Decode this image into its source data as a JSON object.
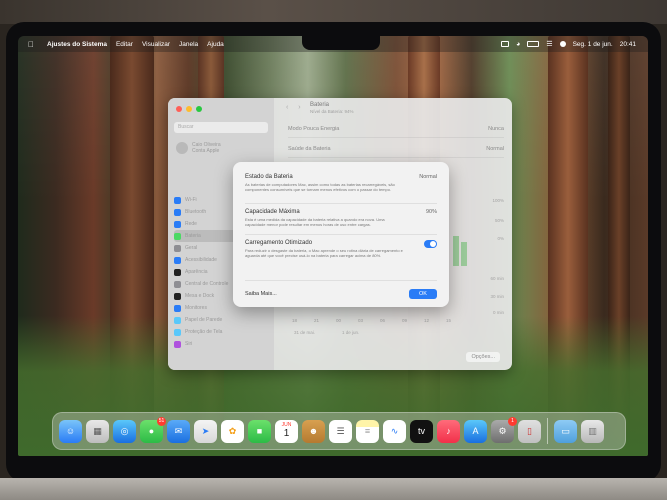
{
  "menubar": {
    "app_name": "Ajustes do Sistema",
    "menus": [
      "Editar",
      "Visualizar",
      "Janela",
      "Ajuda"
    ],
    "date": "Seg. 1 de jun.",
    "time": "20:41"
  },
  "settings_window": {
    "search_placeholder": "Buscar",
    "user_name": "Caio Oliveira",
    "user_subtitle": "Conta Apple",
    "title": "Bateria",
    "subtitle": "Nível da Bateria: 94%",
    "rows": [
      {
        "label": "Modo Pouca Energia",
        "value": "Nunca"
      },
      {
        "label": "Saúde da Bateria",
        "value": "Normal"
      }
    ],
    "sidebar_items": [
      {
        "label": "Wi-Fi",
        "color": "#2a7cf6"
      },
      {
        "label": "Bluetooth",
        "color": "#2a7cf6"
      },
      {
        "label": "Rede",
        "color": "#2a7cf6"
      },
      {
        "label": "Bateria",
        "color": "#4cd964"
      },
      {
        "label": "Geral",
        "color": "#8e8e93"
      },
      {
        "label": "Acessibilidade",
        "color": "#2a7cf6"
      },
      {
        "label": "Aparência",
        "color": "#222222"
      },
      {
        "label": "Central de Controle",
        "color": "#8e8e93"
      },
      {
        "label": "Mesa e Dock",
        "color": "#222222"
      },
      {
        "label": "Monitores",
        "color": "#2a7cf6"
      },
      {
        "label": "Papel de Parede",
        "color": "#5ac8fa"
      },
      {
        "label": "Proteção de Tela",
        "color": "#5ac8fa"
      },
      {
        "label": "Siri",
        "color": "#af52de"
      }
    ],
    "chart_ticks_y": [
      "100%",
      "50%",
      "0%",
      "60 min",
      "30 min",
      "0 min"
    ],
    "chart_ticks_x": [
      "18",
      "21",
      "00",
      "03",
      "06",
      "09",
      "12",
      "15"
    ],
    "chart_dates": [
      "31 de mai.",
      "1 de jun."
    ],
    "options_label": "Opções..."
  },
  "dialog": {
    "sections": [
      {
        "title": "Estado da Bateria",
        "value": "Normal",
        "description": "As baterias de computadores Mac, assim como todas as baterias recarregáveis, são componentes consumíveis que se tornam menos efetivos com o passar do tempo."
      },
      {
        "title": "Capacidade Máxima",
        "value": "90%",
        "description": "Esta é uma medida da capacidade da bateria relativa a quando era nova. Uma capacidade menor pode resultar em menos horas de uso entre cargas."
      },
      {
        "title": "Carregamento Otimizado",
        "toggle_on": true,
        "description": "Para reduzir o desgaste da bateria, o Mac aprende o seu rotina diária de carregamento e aguarda até que você precise usá-lo na bateria para carregar acima de 80%."
      }
    ],
    "learn_more": "Saiba Mais...",
    "ok_label": "OK"
  },
  "dock": {
    "calendar_month": "JUN",
    "calendar_day": "1",
    "messages_badge": "51",
    "settings_badge": "1"
  }
}
